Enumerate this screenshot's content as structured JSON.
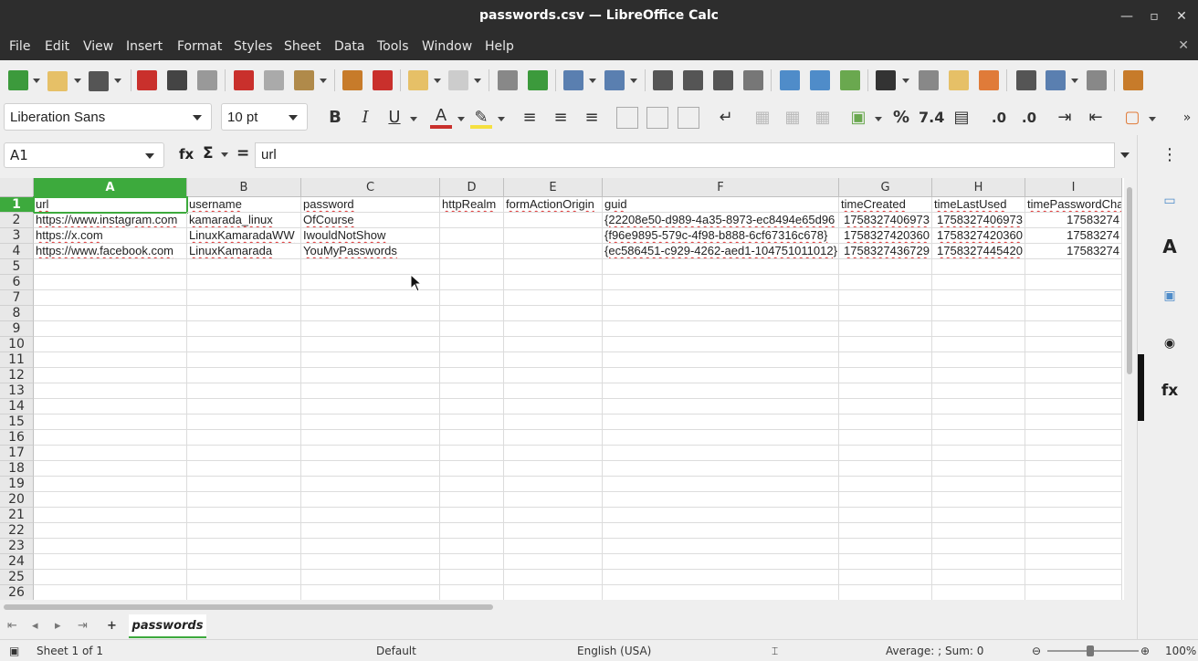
{
  "window": {
    "title": "passwords.csv — LibreOffice Calc"
  },
  "menu": [
    "File",
    "Edit",
    "View",
    "Insert",
    "Format",
    "Styles",
    "Sheet",
    "Data",
    "Tools",
    "Window",
    "Help"
  ],
  "format": {
    "font_name": "Liberation Sans",
    "font_size": "10 pt",
    "number_format": "7.4",
    "percent": "%"
  },
  "formula_bar": {
    "name_box": "A1",
    "content": "url",
    "sum_symbol": "Σ",
    "equals": "=",
    "fx": "fx"
  },
  "sheet": {
    "columns": [
      "A",
      "B",
      "C",
      "D",
      "E",
      "F",
      "G",
      "H",
      "I"
    ],
    "rows": [
      "1",
      "2",
      "3",
      "4",
      "5",
      "6",
      "7",
      "8",
      "9",
      "10",
      "11",
      "12",
      "13",
      "14",
      "15",
      "16",
      "17",
      "18",
      "19",
      "20",
      "21",
      "22",
      "23",
      "24",
      "25",
      "26"
    ],
    "data": [
      [
        "url",
        "username",
        "password",
        "httpRealm",
        "formActionOrigin",
        "guid",
        "timeCreated",
        "timeLastUsed",
        "timePasswordCha"
      ],
      [
        "https://www.instagram.com",
        "kamarada_linux",
        "OfCourse",
        "",
        "",
        "{22208e50-d989-4a35-8973-ec8494e65d96",
        "1758327406973",
        "1758327406973",
        "17583274"
      ],
      [
        "https://x.com",
        "LinuxKamaradaWW",
        "IwouldNotShow",
        "",
        "",
        "{f96e9895-579c-4f98-b888-6cf67316c678}",
        "1758327420360",
        "1758327420360",
        "17583274"
      ],
      [
        "https://www.facebook.com",
        "LinuxKamarada",
        "YouMyPasswords",
        "",
        "",
        "{ec586451-c929-4262-aed1-104751011012}",
        "1758327436729",
        "1758327445420",
        "17583274"
      ]
    ]
  },
  "tabs": {
    "active": "passwords"
  },
  "status": {
    "sheet": "Sheet 1 of 1",
    "page_style": "Default",
    "language": "English (USA)",
    "summary": "Average: ; Sum: 0",
    "zoom": "100%"
  },
  "colors": {
    "accent": "#3daa3d",
    "titlebar": "#2d2d2d"
  }
}
